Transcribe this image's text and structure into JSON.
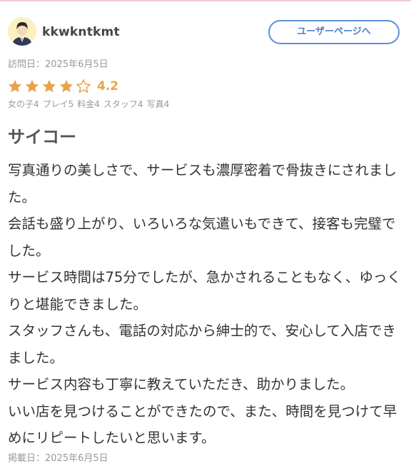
{
  "header": {
    "username": "kkwkntkmt",
    "user_page_button": "ユーザーページへ"
  },
  "visit_date": "訪問日：2025年6月5日",
  "rating": {
    "score": "4.2",
    "value": 4.2,
    "max": 5,
    "star_color": "#e5a44a",
    "sub_ratings": [
      "女の子4",
      "プレイ5",
      "料金4",
      "スタッフ4",
      "写真4"
    ]
  },
  "review": {
    "title": "サイコー",
    "lines": [
      "写真通りの美しさで、サービスも濃厚密着で骨抜きにされました。",
      "会話も盛り上がり、いろいろな気遣いもできて、接客も完璧でした。",
      "サービス時間は75分でしたが、急かされることもなく、ゆっくりと堪能できました。",
      "スタッフさんも、電話の対応から紳士的で、安心して入店できました。",
      "サービス内容も丁寧に教えていただき、助かりました。",
      "いい店を見つけることができたので、また、時間を見つけて早めにリピートしたいと思います。"
    ]
  },
  "posted_date": "掲載日：2025年6月5日"
}
